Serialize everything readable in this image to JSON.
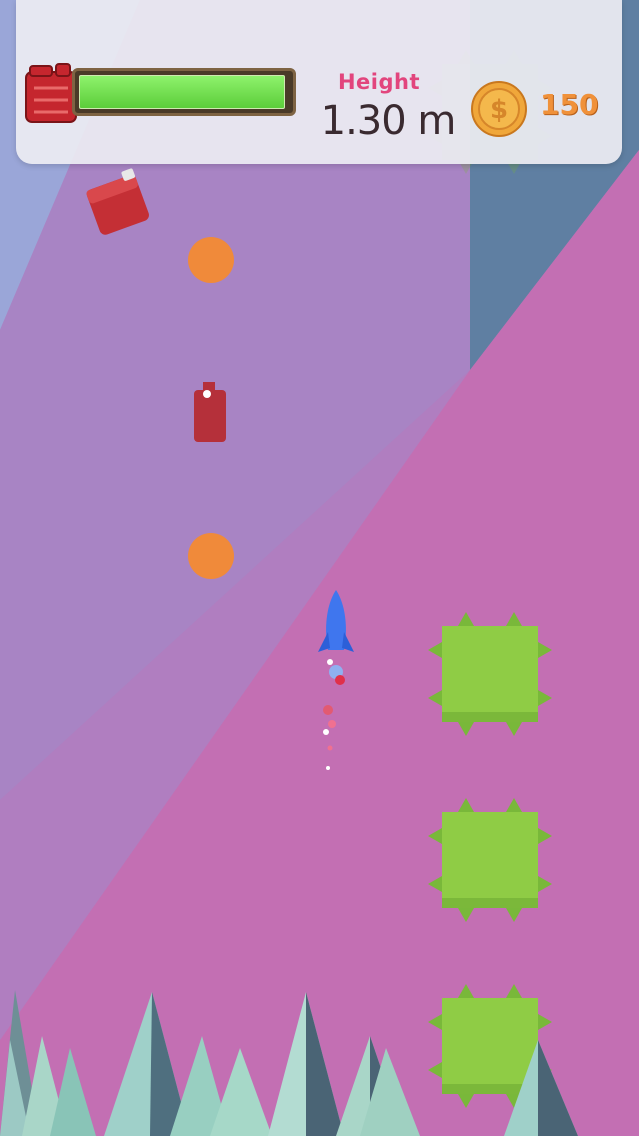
{
  "hud": {
    "height_label": "Height",
    "height_value": "1.30 m",
    "coin_count": "150",
    "fuel_level": 0.98
  },
  "icons": {
    "fuel": "fuel-can-icon",
    "coin": "dollar-coin-icon"
  },
  "colors": {
    "height_label": "#e2457d",
    "coin_count": "#f0913a",
    "fuel_fill": "#6fdc4a",
    "spike_block": "#8fcc45",
    "rocket": "#3f76ee"
  }
}
